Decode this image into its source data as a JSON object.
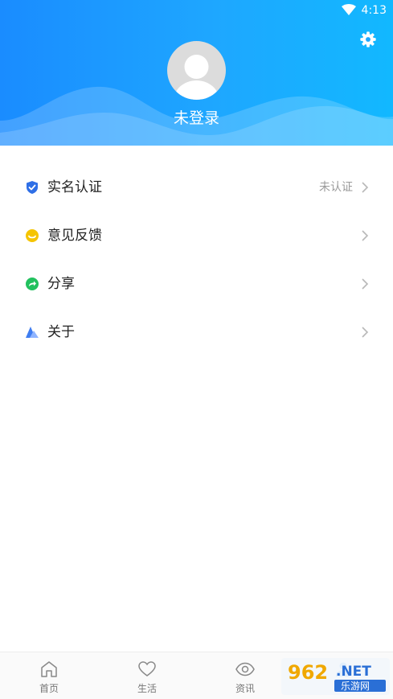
{
  "status_bar": {
    "time": "4:13"
  },
  "profile": {
    "login_status": "未登录"
  },
  "menu": {
    "items": [
      {
        "label": "实名认证",
        "value": "未认证",
        "icon": "shield-check-icon"
      },
      {
        "label": "意见反馈",
        "value": "",
        "icon": "feedback-icon"
      },
      {
        "label": "分享",
        "value": "",
        "icon": "share-icon"
      },
      {
        "label": "关于",
        "value": "",
        "icon": "about-icon"
      }
    ]
  },
  "bottom_nav": {
    "items": [
      {
        "label": "首页",
        "icon": "home-icon"
      },
      {
        "label": "生活",
        "icon": "heart-icon"
      },
      {
        "label": "资讯",
        "icon": "eye-icon"
      },
      {
        "label": "",
        "icon": "profile-icon"
      }
    ]
  },
  "watermark": {
    "text": "962.NET",
    "subtext": "乐游网"
  },
  "colors": {
    "header_start": "#1a8cff",
    "header_end": "#12b8ff",
    "shield": "#2f6fe6",
    "feedback": "#f5c400",
    "share": "#22c15e",
    "about": "#3f7df0"
  }
}
